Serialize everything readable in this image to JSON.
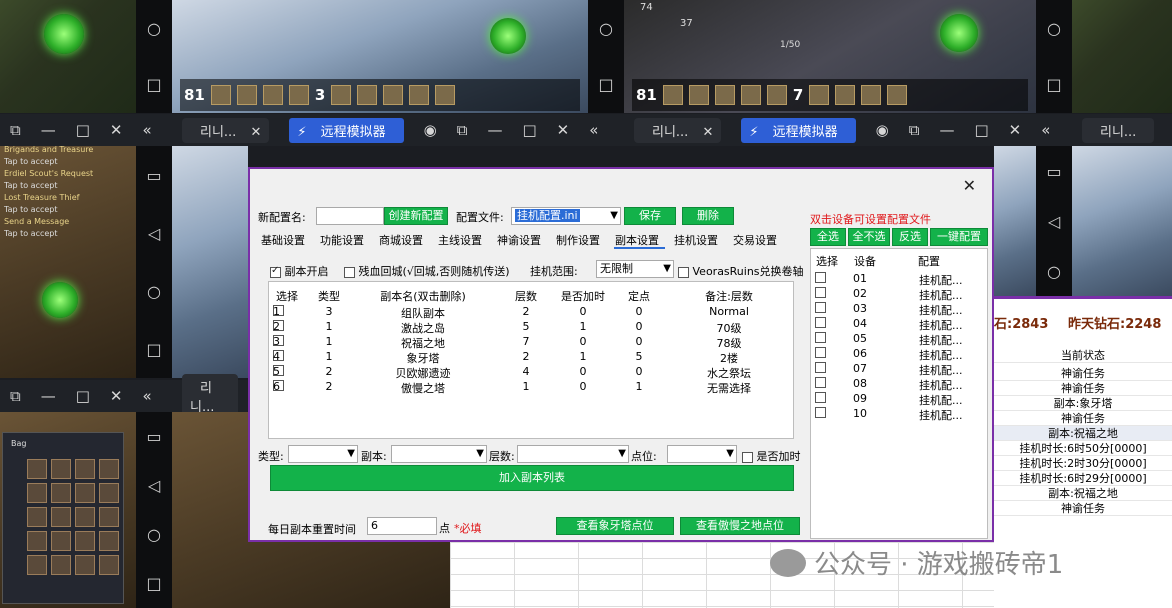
{
  "background": {
    "window_tabs": [
      {
        "app_label": "리니...",
        "remote_label": "远程模拟器"
      },
      {
        "app_label": "리니...",
        "remote_label": "远程模拟器"
      },
      {
        "app_label": "리니..."
      }
    ],
    "hud_numbers": [
      "81",
      "81",
      "3",
      "7"
    ],
    "stats_top": [
      "74",
      "37",
      "1/50"
    ],
    "bag_label": "Bag",
    "quest_lines": [
      "Brigands and Treasure",
      "Tap to accept",
      "Erdiel Scout's Request",
      "Tap to accept",
      "Lost Treasure Thief",
      "Tap to accept",
      "Send a Message",
      "Tap to accept"
    ]
  },
  "dialog": {
    "close_label": "✕",
    "new_config_label": "新配置名:",
    "new_config_value": "",
    "create_button": "创建新配置",
    "config_file_label": "配置文件:",
    "config_file_value": "挂机配置.ini",
    "save_button": "保存",
    "delete_button": "删除",
    "hint_text": "双击设备可设置配置文件",
    "tabs": [
      "基础设置",
      "功能设置",
      "商城设置",
      "主线设置",
      "神谕设置",
      "制作设置",
      "副本设置",
      "挂机设置",
      "交易设置"
    ],
    "active_tab": 6,
    "options": {
      "dungeon_enabled_label": "副本开启",
      "dungeon_enabled": true,
      "low_hp_label": "残血回城(√回城,否则随机传送)",
      "low_hp": false,
      "range_label": "挂机范围:",
      "range_value": "无限制",
      "veoras_label": "VeorasRuins兑换卷轴",
      "veoras": false
    },
    "table": {
      "headers": [
        "选择",
        "类型",
        "副本名(双击删除)",
        "层数",
        "是否加时",
        "定点",
        "备注:层数"
      ],
      "rows": [
        {
          "index": "1",
          "type": "3",
          "name": "组队副本",
          "floors": "2",
          "extra": "0",
          "point": "0",
          "note": "Normal",
          "selected": false
        },
        {
          "index": "2",
          "type": "1",
          "name": "激战之岛",
          "floors": "5",
          "extra": "1",
          "point": "0",
          "note": "70级",
          "selected": false
        },
        {
          "index": "3",
          "type": "1",
          "name": "祝福之地",
          "floors": "7",
          "extra": "0",
          "point": "0",
          "note": "78级",
          "selected": false
        },
        {
          "index": "4",
          "type": "1",
          "name": "象牙塔",
          "floors": "2",
          "extra": "1",
          "point": "5",
          "note": "2楼",
          "selected": false
        },
        {
          "index": "5",
          "type": "2",
          "name": "贝欧娜遗迹",
          "floors": "4",
          "extra": "0",
          "point": "0",
          "note": "水之祭坛",
          "selected": false
        },
        {
          "index": "6",
          "type": "2",
          "name": "傲慢之塔",
          "floors": "1",
          "extra": "0",
          "point": "1",
          "note": "无需选择",
          "selected": false
        }
      ]
    },
    "filters": {
      "type_label": "类型:",
      "dungeon_label": "副本:",
      "floors_label": "层数:",
      "point_label": "点位:",
      "extra_label": "是否加时"
    },
    "add_button": "加入副本列表",
    "reset_label": "每日副本重置时间",
    "reset_value": "6",
    "reset_unit": "点",
    "required_label": "*必填",
    "view_ivory_button": "查看象牙塔点位",
    "view_pride_button": "查看傲慢之地点位",
    "device_panel": {
      "select_all": "全选",
      "select_none": "全不选",
      "invert": "反选",
      "one_click": "一键配置",
      "headers": [
        "选择",
        "设备",
        "配置"
      ],
      "devices": [
        {
          "id": "01",
          "config": "挂机配..."
        },
        {
          "id": "02",
          "config": "挂机配..."
        },
        {
          "id": "03",
          "config": "挂机配..."
        },
        {
          "id": "04",
          "config": "挂机配..."
        },
        {
          "id": "05",
          "config": "挂机配..."
        },
        {
          "id": "06",
          "config": "挂机配..."
        },
        {
          "id": "07",
          "config": "挂机配..."
        },
        {
          "id": "08",
          "config": "挂机配..."
        },
        {
          "id": "09",
          "config": "挂机配..."
        },
        {
          "id": "10",
          "config": "挂机配..."
        }
      ]
    }
  },
  "sheet": {
    "top_left": "石:2843",
    "top_right": "昨天钻石:2248",
    "header": "当前状态",
    "rows": [
      "神谕任务",
      "神谕任务",
      "副本:象牙塔",
      "神谕任务",
      "副本:祝福之地",
      "挂机时长:6时50分[0000]",
      "挂机时长:2时30分[0000]",
      "挂机时长:6时29分[0000]",
      "副本:祝福之地",
      "神谕任务"
    ]
  },
  "watermark": "公众号 · 游戏搬砖帝1"
}
